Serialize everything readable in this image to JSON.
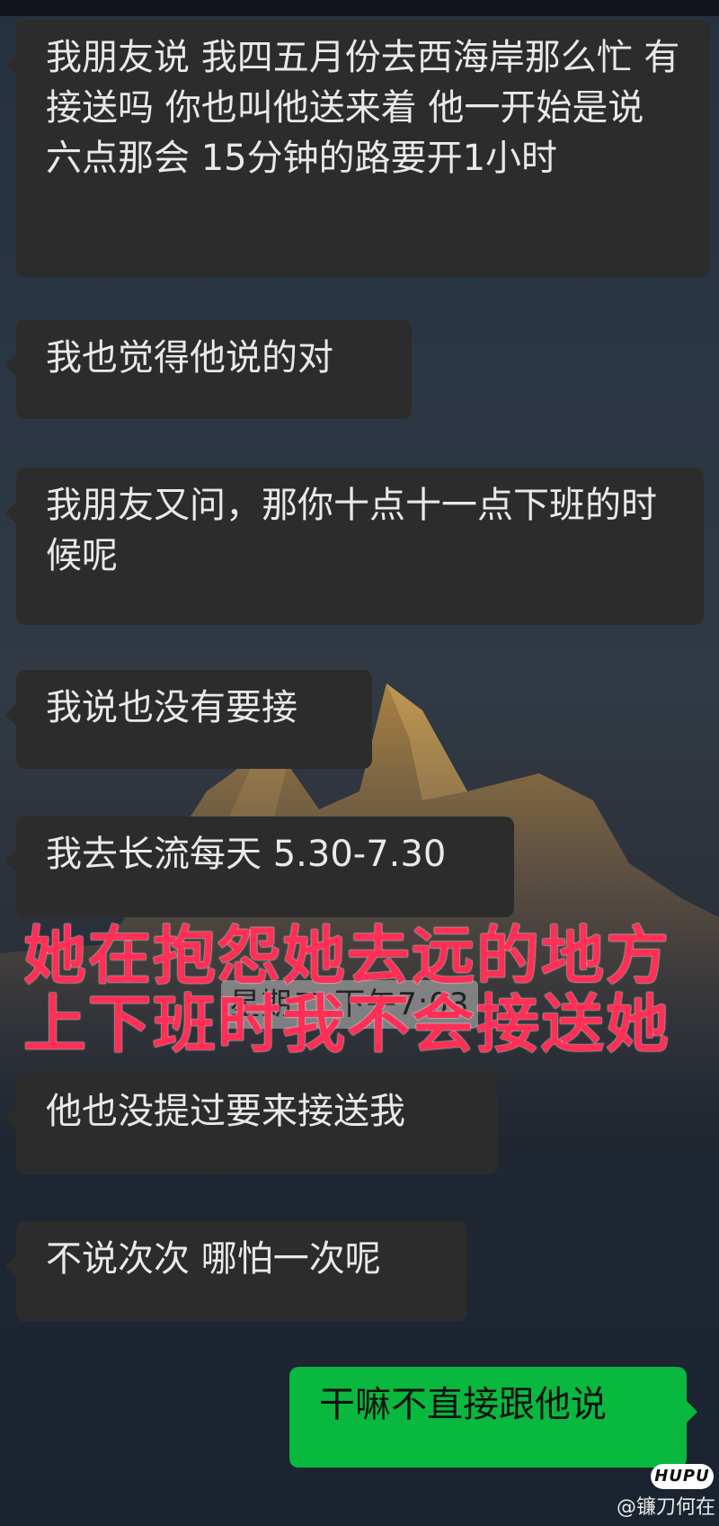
{
  "messages": [
    {
      "side": "left",
      "text": "我朋友说 我四五月份去西海岸那么忙 有接送吗 你也叫他送来着 他一开始是说 六点那会 15分钟的路要开1小时"
    },
    {
      "side": "left",
      "text": "我也觉得他说的对"
    },
    {
      "side": "left",
      "text": "我朋友又问，那你十点十一点下班的时候呢"
    },
    {
      "side": "left",
      "text": "我说也没有要接"
    },
    {
      "side": "left",
      "text": "我去长流每天 5.30-7.30"
    },
    {
      "side": "left",
      "text": "他也没提过要来接送我"
    },
    {
      "side": "left",
      "text": "不说次次 哪怕一次呢"
    },
    {
      "side": "right",
      "text": "干嘛不直接跟他说"
    }
  ],
  "time_pill": "星期二 下午7:03",
  "overlay": {
    "line1": "她在抱怨她去远的地方",
    "line2": "上下班时我不会接送她",
    "color": "#ff2f55"
  },
  "watermark": {
    "logo": "HUPU",
    "text": "@镰刀何在"
  },
  "colors": {
    "incoming_bubble": "#2c2c2c",
    "outgoing_bubble": "#09b83e"
  }
}
